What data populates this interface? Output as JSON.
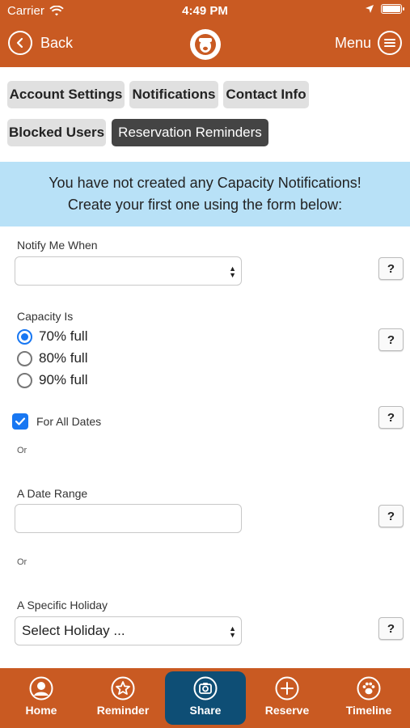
{
  "status": {
    "carrier": "Carrier",
    "time": "4:49 PM"
  },
  "nav": {
    "back_label": "Back",
    "menu_label": "Menu"
  },
  "tabs": [
    {
      "label": "Account Settings"
    },
    {
      "label": "Notifications"
    },
    {
      "label": "Contact Info"
    },
    {
      "label": "Blocked Users"
    },
    {
      "label": "Reservation Reminders",
      "active": true
    }
  ],
  "banner": {
    "line1": "You have not created any Capacity Notifications!",
    "line2": "Create your first one using the form below:"
  },
  "form": {
    "notify_label": "Notify Me When",
    "notify_value": "",
    "capacity_label": "Capacity Is",
    "capacity_options": [
      {
        "label": "70% full",
        "selected": true
      },
      {
        "label": "80% full",
        "selected": false
      },
      {
        "label": "90% full",
        "selected": false
      }
    ],
    "all_dates_label": "For All Dates",
    "all_dates_checked": true,
    "or_1": "Or",
    "date_range_label": "A Date Range",
    "or_2": "Or",
    "holiday_label": "A Specific Holiday",
    "holiday_value": "Select Holiday ...",
    "help_label": "?"
  },
  "bottom_tabs": [
    {
      "label": "Home",
      "icon": "user-icon"
    },
    {
      "label": "Reminder",
      "icon": "star-icon"
    },
    {
      "label": "Share",
      "icon": "camera-icon",
      "active": true
    },
    {
      "label": "Reserve",
      "icon": "plus-icon"
    },
    {
      "label": "Timeline",
      "icon": "paw-icon"
    }
  ],
  "colors": {
    "brand": "#c95a22",
    "active_tab": "#0e4e75",
    "banner": "#b8e1f7",
    "accent": "#1877f2"
  }
}
